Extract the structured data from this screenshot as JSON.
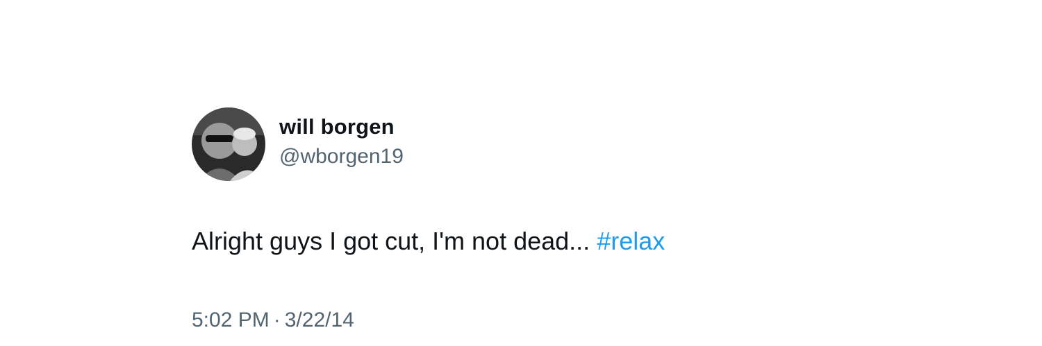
{
  "author": {
    "display_name": "will borgen",
    "handle": "@wborgen19"
  },
  "tweet": {
    "text": "Alright guys I got cut, I'm not dead...",
    "hashtag": "#relax"
  },
  "meta": {
    "time": "5:02 PM",
    "separator": "·",
    "date": "3/22/14"
  },
  "colors": {
    "text": "#0f1419",
    "secondary": "#536471",
    "link": "#1d9bf0",
    "background": "#ffffff"
  }
}
